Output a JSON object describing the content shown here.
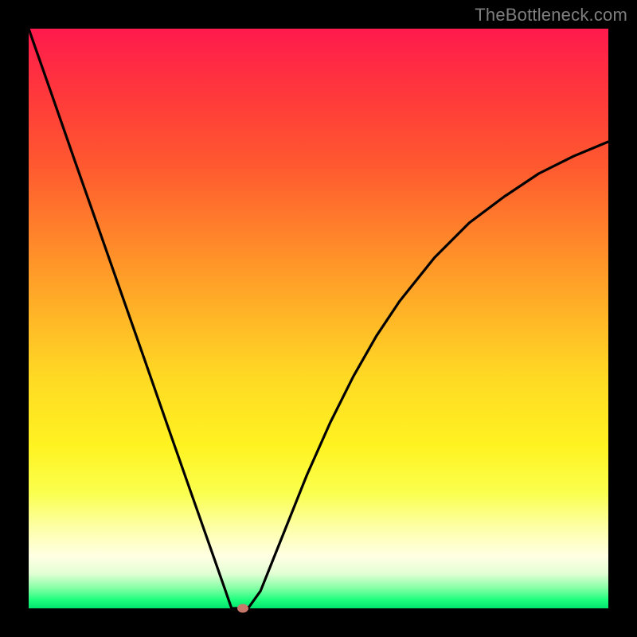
{
  "watermark": "TheBottleneck.com",
  "colors": {
    "frame": "#000000",
    "curve": "#000000",
    "marker": "#c8786b"
  },
  "chart_data": {
    "type": "line",
    "title": "",
    "xlabel": "",
    "ylabel": "",
    "xlim": [
      0,
      100
    ],
    "ylim": [
      0,
      100
    ],
    "series": [
      {
        "name": "bottleneck-curve",
        "x": [
          0,
          4,
          8,
          12,
          16,
          20,
          24,
          28,
          32,
          34,
          35,
          36,
          37,
          38,
          40,
          44,
          48,
          52,
          56,
          60,
          64,
          70,
          76,
          82,
          88,
          94,
          100
        ],
        "y": [
          100.0,
          88.6,
          77.1,
          65.7,
          54.3,
          42.9,
          31.4,
          20.0,
          8.6,
          2.9,
          0.0,
          0.0,
          0.0,
          0.2,
          3.0,
          13.0,
          23.0,
          32.0,
          40.0,
          47.0,
          53.0,
          60.5,
          66.5,
          71.0,
          75.0,
          78.0,
          80.5
        ]
      }
    ],
    "annotations": [
      {
        "name": "optimal-point",
        "x": 37,
        "y": 0
      }
    ],
    "background": "red-yellow-green vertical gradient"
  }
}
